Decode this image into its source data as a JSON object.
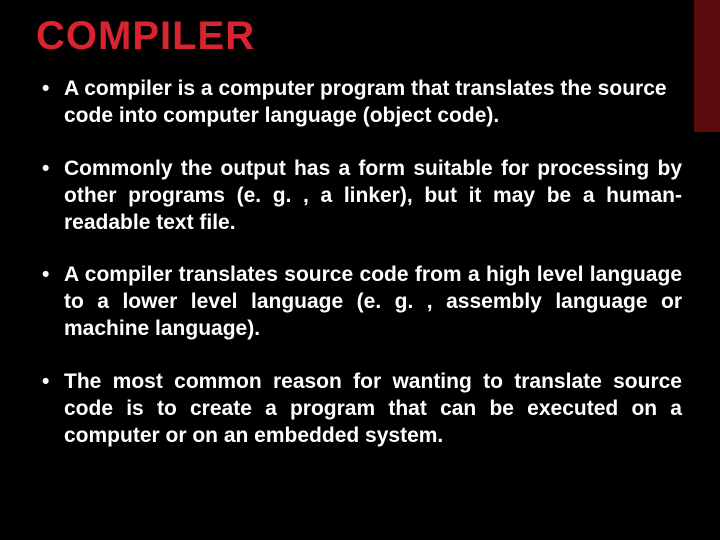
{
  "slide": {
    "title": "COMPILER",
    "bullets": [
      "A compiler is a computer program that translates the source code into computer language (object code).",
      "Commonly the output has a form suitable for processing by other programs (e. g. , a linker), but it may be a human-readable text file.",
      "A compiler translates source code from a high level language to a lower level language (e. g. , assembly language or machine language).",
      "The most common reason for wanting to translate source code is to create a program that can be executed on a computer or on an embedded system."
    ]
  },
  "colors": {
    "background": "#000000",
    "title": "#d9232e",
    "accent_bar": "#5a0c0c",
    "text": "#ffffff"
  }
}
